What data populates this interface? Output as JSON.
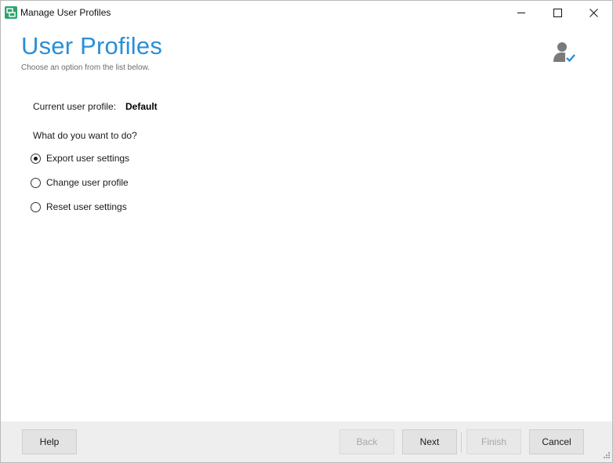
{
  "window": {
    "title": "Manage User Profiles"
  },
  "header": {
    "title": "User Profiles",
    "subtitle": "Choose an option from the list below."
  },
  "profile": {
    "label": "Current user profile:",
    "value": "Default"
  },
  "question": "What do you want to do?",
  "options": [
    {
      "label": "Export user settings",
      "selected": true
    },
    {
      "label": "Change user profile",
      "selected": false
    },
    {
      "label": "Reset user settings",
      "selected": false
    }
  ],
  "footer": {
    "help": "Help",
    "back": "Back",
    "next": "Next",
    "finish": "Finish",
    "cancel": "Cancel"
  },
  "colors": {
    "accent": "#2b8fd6",
    "footer_bg": "#eeeeee",
    "icon_green": "#2ea46a"
  },
  "icons": [
    "app-icon",
    "minimize-icon",
    "maximize-icon",
    "close-icon",
    "user-check-icon",
    "resize-grip-icon"
  ]
}
